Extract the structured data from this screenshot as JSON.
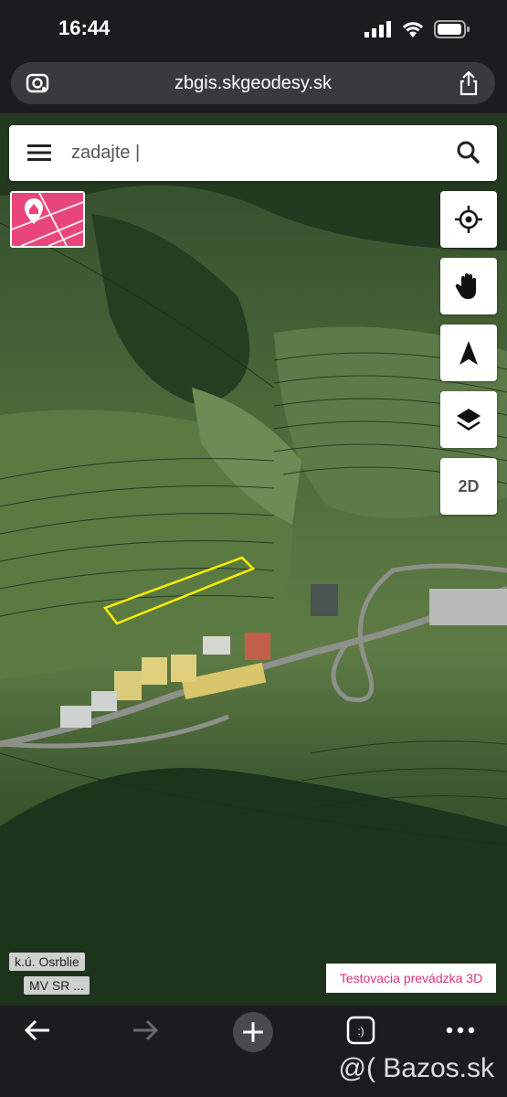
{
  "status_bar": {
    "time": "16:44"
  },
  "browser": {
    "url": "zbgis.skgeodesy.sk"
  },
  "search": {
    "value": "zadajte |"
  },
  "map_controls": {
    "mode_label": "2D"
  },
  "map_labels": {
    "cadastral_area": "k.ú. Osrblie",
    "source": "MV SR ...",
    "test_notice": "Testovacia prevádzka 3D"
  },
  "watermark": "@( Bazos.sk",
  "colors": {
    "parcel_highlight": "#ffee00",
    "logo": "#e8457d",
    "test_notice_text": "#e0327a"
  }
}
